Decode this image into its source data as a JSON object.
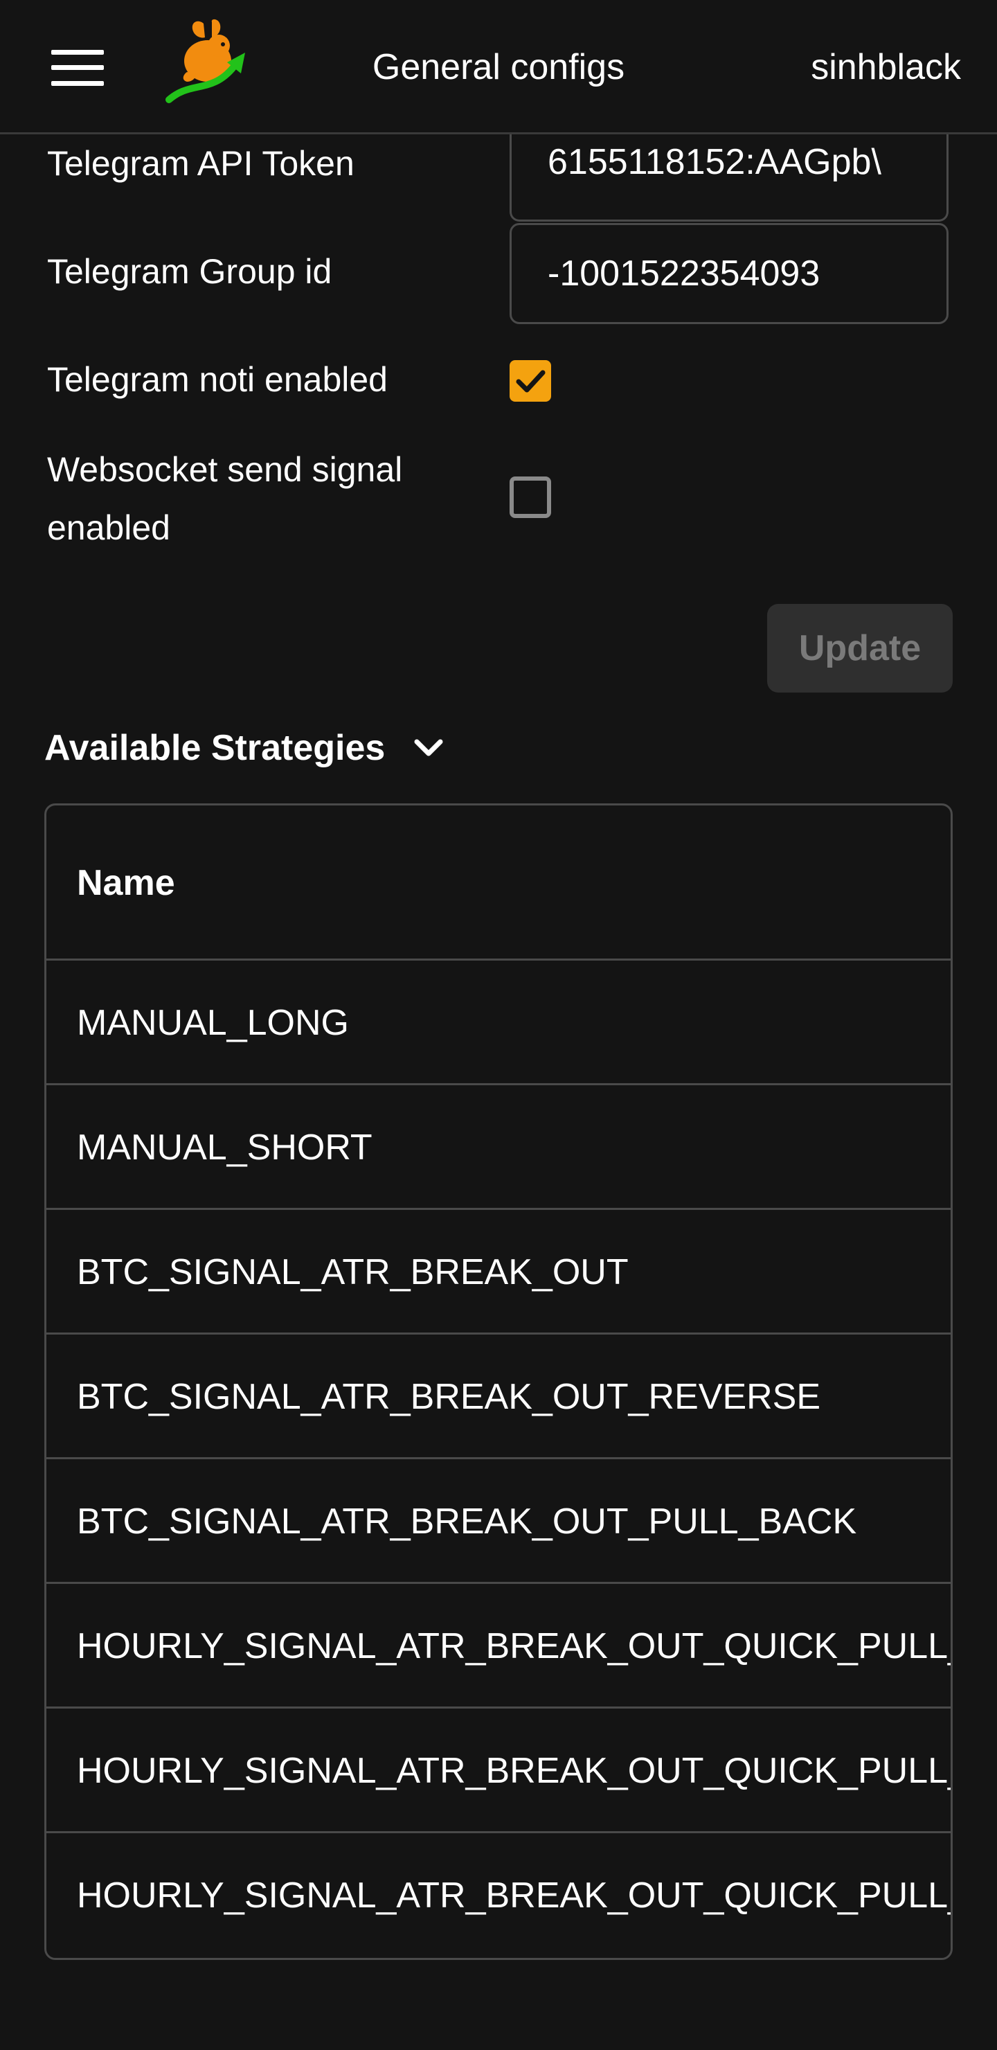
{
  "header": {
    "title": "General configs",
    "username": "sinhblack"
  },
  "form": {
    "telegram_api_token": {
      "label": "Telegram API Token",
      "value": "6155118152:AAGpb\\"
    },
    "telegram_group_id": {
      "label": "Telegram Group id",
      "value": "-1001522354093"
    },
    "telegram_noti_enabled": {
      "label": "Telegram noti enabled",
      "checked": true
    },
    "websocket_send_signal_enabled": {
      "label_line1": "Websocket send signal",
      "label_line2": "enabled",
      "checked": false
    },
    "update_label": "Update"
  },
  "strategies": {
    "section_title": "Available Strategies",
    "column_name": "Name",
    "rows": [
      "MANUAL_LONG",
      "MANUAL_SHORT",
      "BTC_SIGNAL_ATR_BREAK_OUT",
      "BTC_SIGNAL_ATR_BREAK_OUT_REVERSE",
      "BTC_SIGNAL_ATR_BREAK_OUT_PULL_BACK",
      "HOURLY_SIGNAL_ATR_BREAK_OUT_QUICK_PULL_",
      "HOURLY_SIGNAL_ATR_BREAK_OUT_QUICK_PULL_",
      "HOURLY_SIGNAL_ATR_BREAK_OUT_QUICK_PULL_"
    ]
  },
  "colors": {
    "background": "#141414",
    "accent": "#f4a20f",
    "logo_orange": "#f28c0f",
    "logo_green": "#22c21a",
    "border": "#4a4a4a",
    "button_disabled_bg": "#2f2f2f"
  }
}
